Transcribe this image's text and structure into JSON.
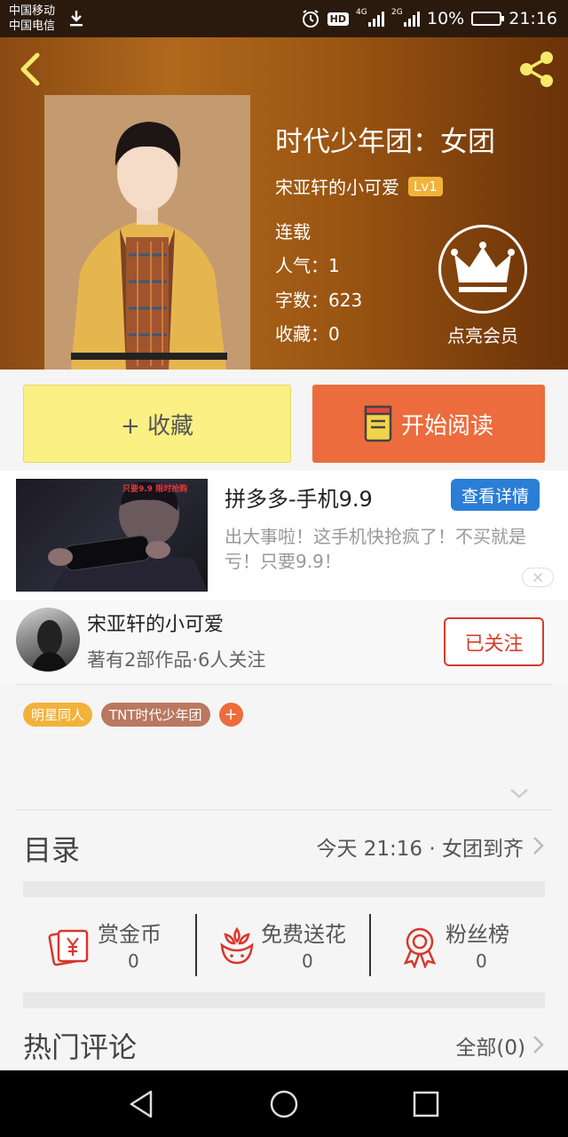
{
  "status_bar": {
    "carrier1": "中国移动",
    "carrier2": "中国电信",
    "net1": "4G",
    "net2": "2G",
    "battery": "10%",
    "time": "21:16"
  },
  "book": {
    "title": "时代少年团：女团",
    "author": "宋亚轩的小可爱",
    "level": "Lv1",
    "status": "连载",
    "popularity": "人气：1",
    "word_count": "字数：623",
    "favorites": "收藏：0",
    "vip_label": "点亮会员"
  },
  "actions": {
    "collect": "+ 收藏",
    "read": "开始阅读"
  },
  "ad": {
    "image_caption": "只要9.9   限时抢购",
    "title": "拼多多-手机9.9",
    "detail_btn": "查看详情",
    "description": "出大事啦！这手机快抢疯了！不买就是亏！只要9.9！"
  },
  "author": {
    "name": "宋亚轩的小可爱",
    "stats": "著有2部作品·6人关注",
    "follow_btn": "已关注"
  },
  "tags": [
    {
      "label": "明星同人",
      "color": "#f2b23a"
    },
    {
      "label": "TNT时代少年团",
      "color": "#b97860"
    }
  ],
  "catalog": {
    "label": "目录",
    "latest": "今天 21:16 · 女团到齐"
  },
  "stats": [
    {
      "label": "赏金币",
      "value": "0",
      "icon": "red-envelope-icon"
    },
    {
      "label": "免费送花",
      "value": "0",
      "icon": "flower-icon"
    },
    {
      "label": "粉丝榜",
      "value": "0",
      "icon": "medal-icon"
    }
  ],
  "comments": {
    "label": "热门评论",
    "all": "全部(0)"
  },
  "colors": {
    "accent_orange": "#ec6c3d",
    "collect_yellow": "#fbf083",
    "follow_red": "#d43d2a",
    "detail_blue": "#2a7ed6",
    "icon_red": "#d9362a"
  }
}
